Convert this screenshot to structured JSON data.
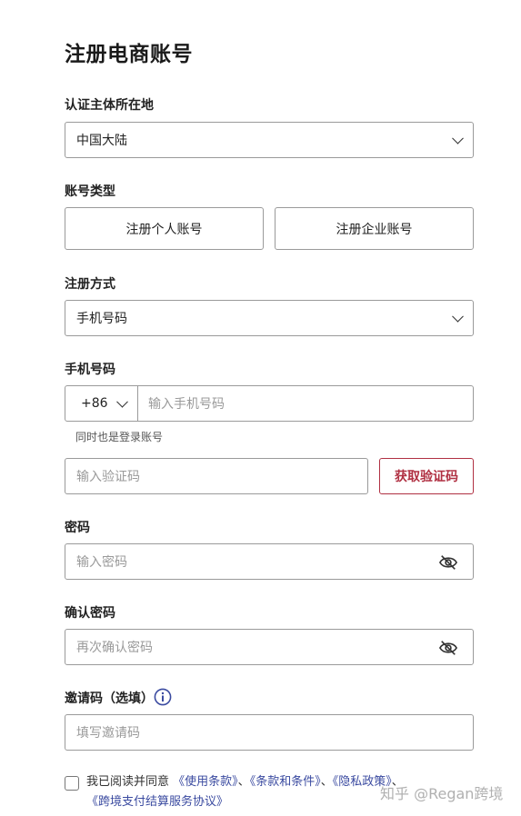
{
  "page_title": "注册电商账号",
  "region": {
    "label": "认证主体所在地",
    "value": "中国大陆"
  },
  "account_type": {
    "label": "账号类型",
    "personal": "注册个人账号",
    "business": "注册企业账号"
  },
  "method": {
    "label": "注册方式",
    "value": "手机号码"
  },
  "phone": {
    "label": "手机号码",
    "country_code": "+86",
    "placeholder": "输入手机号码",
    "hint": "同时也是登录账号"
  },
  "verify": {
    "placeholder": "输入验证码",
    "button": "获取验证码"
  },
  "password": {
    "label": "密码",
    "placeholder": "输入密码"
  },
  "confirm_password": {
    "label": "确认密码",
    "placeholder": "再次确认密码"
  },
  "invite": {
    "label": "邀请码（选填）",
    "placeholder": "填写邀请码"
  },
  "agreement": {
    "prefix": "我已阅读并同意",
    "terms_of_use": "《使用条款》",
    "sep1": "、",
    "terms_conditions": "《条款和条件》",
    "sep2": "、",
    "privacy": "《隐私政策》",
    "sep3": "、",
    "cross_border": "《跨境支付结算服务协议》"
  },
  "watermark": "知乎 @Regan跨境",
  "colors": {
    "accent": "#b03042",
    "link": "#3a4aa0",
    "border": "#9a9a9a"
  },
  "icons": {
    "dropdown": "chevron-down-icon",
    "password_toggle": "eye-off-icon",
    "info": "info-icon"
  }
}
